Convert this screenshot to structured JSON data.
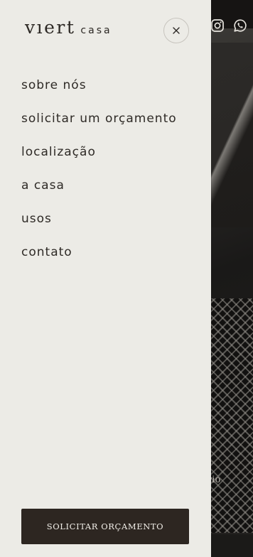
{
  "brand": {
    "logo_mark": "vıert",
    "logo_word": "casa"
  },
  "nav": {
    "items": [
      {
        "label": "sobre nós"
      },
      {
        "label": "solicitar um orçamento"
      },
      {
        "label": "localização"
      },
      {
        "label": "a casa"
      },
      {
        "label": "usos"
      },
      {
        "label": "contato"
      }
    ]
  },
  "cta": {
    "label": "SOLICITAR ORÇAMENTO"
  },
  "background": {
    "caption": "cenário"
  },
  "icons": {
    "close": "close-icon",
    "instagram": "instagram-icon",
    "whatsapp": "whatsapp-icon"
  },
  "colors": {
    "drawer_bg": "#ecebe6",
    "text": "#2e2a26",
    "cta_bg": "#2d2621",
    "cta_text": "#f2efe9"
  }
}
